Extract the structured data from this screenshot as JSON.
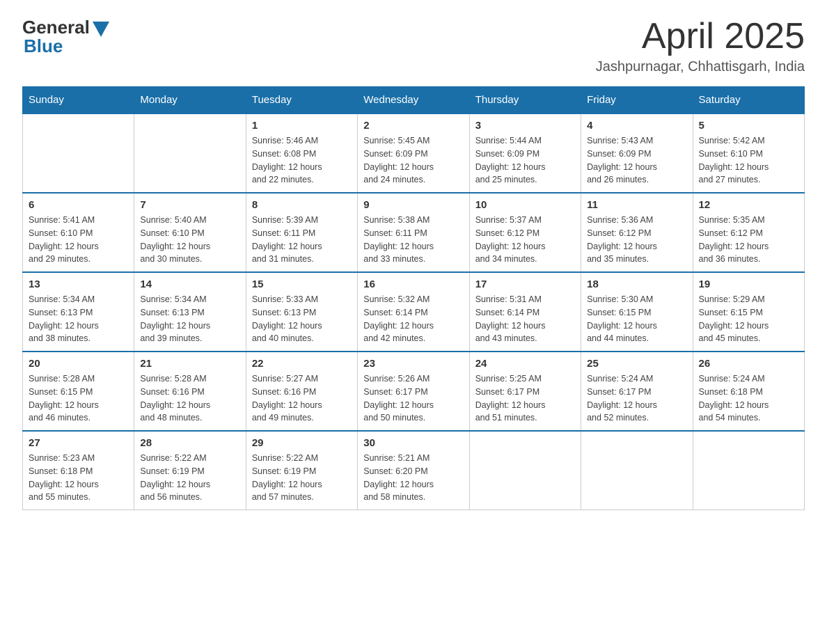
{
  "logo": {
    "general": "General",
    "blue": "Blue"
  },
  "title": "April 2025",
  "subtitle": "Jashpurnagar, Chhattisgarh, India",
  "days": [
    "Sunday",
    "Monday",
    "Tuesday",
    "Wednesday",
    "Thursday",
    "Friday",
    "Saturday"
  ],
  "weeks": [
    [
      {
        "day": "",
        "info": ""
      },
      {
        "day": "",
        "info": ""
      },
      {
        "day": "1",
        "info": "Sunrise: 5:46 AM\nSunset: 6:08 PM\nDaylight: 12 hours\nand 22 minutes."
      },
      {
        "day": "2",
        "info": "Sunrise: 5:45 AM\nSunset: 6:09 PM\nDaylight: 12 hours\nand 24 minutes."
      },
      {
        "day": "3",
        "info": "Sunrise: 5:44 AM\nSunset: 6:09 PM\nDaylight: 12 hours\nand 25 minutes."
      },
      {
        "day": "4",
        "info": "Sunrise: 5:43 AM\nSunset: 6:09 PM\nDaylight: 12 hours\nand 26 minutes."
      },
      {
        "day": "5",
        "info": "Sunrise: 5:42 AM\nSunset: 6:10 PM\nDaylight: 12 hours\nand 27 minutes."
      }
    ],
    [
      {
        "day": "6",
        "info": "Sunrise: 5:41 AM\nSunset: 6:10 PM\nDaylight: 12 hours\nand 29 minutes."
      },
      {
        "day": "7",
        "info": "Sunrise: 5:40 AM\nSunset: 6:10 PM\nDaylight: 12 hours\nand 30 minutes."
      },
      {
        "day": "8",
        "info": "Sunrise: 5:39 AM\nSunset: 6:11 PM\nDaylight: 12 hours\nand 31 minutes."
      },
      {
        "day": "9",
        "info": "Sunrise: 5:38 AM\nSunset: 6:11 PM\nDaylight: 12 hours\nand 33 minutes."
      },
      {
        "day": "10",
        "info": "Sunrise: 5:37 AM\nSunset: 6:12 PM\nDaylight: 12 hours\nand 34 minutes."
      },
      {
        "day": "11",
        "info": "Sunrise: 5:36 AM\nSunset: 6:12 PM\nDaylight: 12 hours\nand 35 minutes."
      },
      {
        "day": "12",
        "info": "Sunrise: 5:35 AM\nSunset: 6:12 PM\nDaylight: 12 hours\nand 36 minutes."
      }
    ],
    [
      {
        "day": "13",
        "info": "Sunrise: 5:34 AM\nSunset: 6:13 PM\nDaylight: 12 hours\nand 38 minutes."
      },
      {
        "day": "14",
        "info": "Sunrise: 5:34 AM\nSunset: 6:13 PM\nDaylight: 12 hours\nand 39 minutes."
      },
      {
        "day": "15",
        "info": "Sunrise: 5:33 AM\nSunset: 6:13 PM\nDaylight: 12 hours\nand 40 minutes."
      },
      {
        "day": "16",
        "info": "Sunrise: 5:32 AM\nSunset: 6:14 PM\nDaylight: 12 hours\nand 42 minutes."
      },
      {
        "day": "17",
        "info": "Sunrise: 5:31 AM\nSunset: 6:14 PM\nDaylight: 12 hours\nand 43 minutes."
      },
      {
        "day": "18",
        "info": "Sunrise: 5:30 AM\nSunset: 6:15 PM\nDaylight: 12 hours\nand 44 minutes."
      },
      {
        "day": "19",
        "info": "Sunrise: 5:29 AM\nSunset: 6:15 PM\nDaylight: 12 hours\nand 45 minutes."
      }
    ],
    [
      {
        "day": "20",
        "info": "Sunrise: 5:28 AM\nSunset: 6:15 PM\nDaylight: 12 hours\nand 46 minutes."
      },
      {
        "day": "21",
        "info": "Sunrise: 5:28 AM\nSunset: 6:16 PM\nDaylight: 12 hours\nand 48 minutes."
      },
      {
        "day": "22",
        "info": "Sunrise: 5:27 AM\nSunset: 6:16 PM\nDaylight: 12 hours\nand 49 minutes."
      },
      {
        "day": "23",
        "info": "Sunrise: 5:26 AM\nSunset: 6:17 PM\nDaylight: 12 hours\nand 50 minutes."
      },
      {
        "day": "24",
        "info": "Sunrise: 5:25 AM\nSunset: 6:17 PM\nDaylight: 12 hours\nand 51 minutes."
      },
      {
        "day": "25",
        "info": "Sunrise: 5:24 AM\nSunset: 6:17 PM\nDaylight: 12 hours\nand 52 minutes."
      },
      {
        "day": "26",
        "info": "Sunrise: 5:24 AM\nSunset: 6:18 PM\nDaylight: 12 hours\nand 54 minutes."
      }
    ],
    [
      {
        "day": "27",
        "info": "Sunrise: 5:23 AM\nSunset: 6:18 PM\nDaylight: 12 hours\nand 55 minutes."
      },
      {
        "day": "28",
        "info": "Sunrise: 5:22 AM\nSunset: 6:19 PM\nDaylight: 12 hours\nand 56 minutes."
      },
      {
        "day": "29",
        "info": "Sunrise: 5:22 AM\nSunset: 6:19 PM\nDaylight: 12 hours\nand 57 minutes."
      },
      {
        "day": "30",
        "info": "Sunrise: 5:21 AM\nSunset: 6:20 PM\nDaylight: 12 hours\nand 58 minutes."
      },
      {
        "day": "",
        "info": ""
      },
      {
        "day": "",
        "info": ""
      },
      {
        "day": "",
        "info": ""
      }
    ]
  ]
}
